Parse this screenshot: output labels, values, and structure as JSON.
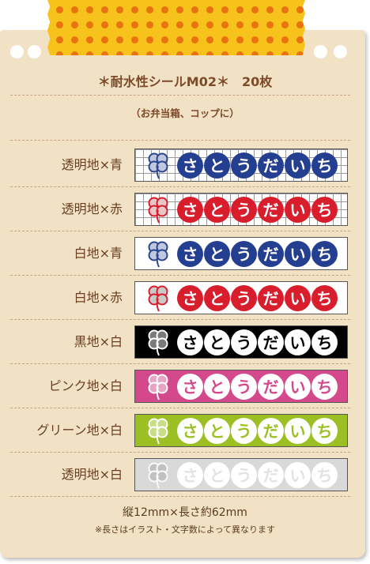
{
  "header": {
    "title": "＊耐水性シールM02＊　20枚",
    "subtitle": "（お弁当箱、コップに）"
  },
  "name_text": [
    "さ",
    "と",
    "う",
    "だ",
    "い",
    "ち"
  ],
  "rows": [
    {
      "label": "透明地×青",
      "bg": "#ffffff",
      "grid": true,
      "circle": "#243f8f",
      "text": "#ffffff",
      "clover_fill": "#bfc8dc",
      "clover_stroke": "#2b4690",
      "faded": false
    },
    {
      "label": "透明地×赤",
      "bg": "#ffffff",
      "grid": true,
      "circle": "#d81e2c",
      "text": "#ffffff",
      "clover_fill": "#e6c6c9",
      "clover_stroke": "#d81e2c",
      "faded": false
    },
    {
      "label": "白地×青",
      "bg": "#ffffff",
      "grid": false,
      "circle": "#243f8f",
      "text": "#ffffff",
      "clover_fill": "#bfc8dc",
      "clover_stroke": "#2b4690",
      "faded": false
    },
    {
      "label": "白地×赤",
      "bg": "#ffffff",
      "grid": false,
      "circle": "#d81e2c",
      "text": "#ffffff",
      "clover_fill": "#c9c9c9",
      "clover_stroke": "#d81e2c",
      "faded": false
    },
    {
      "label": "黒地×白",
      "bg": "#000000",
      "grid": false,
      "circle": "#ffffff",
      "text": "#000000",
      "clover_fill": "#7a7a7a",
      "clover_stroke": "#ffffff",
      "faded": false
    },
    {
      "label": "ピンク地×白",
      "bg": "#d4498c",
      "grid": false,
      "circle": "#ffffff",
      "text": "#d4498c",
      "clover_fill": "#e9a3c4",
      "clover_stroke": "#ffffff",
      "faded": false
    },
    {
      "label": "グリーン地×白",
      "bg": "#9cc024",
      "grid": false,
      "circle": "#ffffff",
      "text": "#9cc024",
      "clover_fill": "#c9dd86",
      "clover_stroke": "#ffffff",
      "faded": false
    },
    {
      "label": "透明地×白",
      "bg": "#d9d9d9",
      "grid": false,
      "circle": "#ffffff",
      "text": "#e3e3e3",
      "clover_fill": "#bdbdbd",
      "clover_stroke": "#ffffff",
      "faded": true
    }
  ],
  "footer": {
    "size": "縦12mm×長さ約62mm",
    "note": "※長さはイラスト・文字数によって異なります"
  }
}
